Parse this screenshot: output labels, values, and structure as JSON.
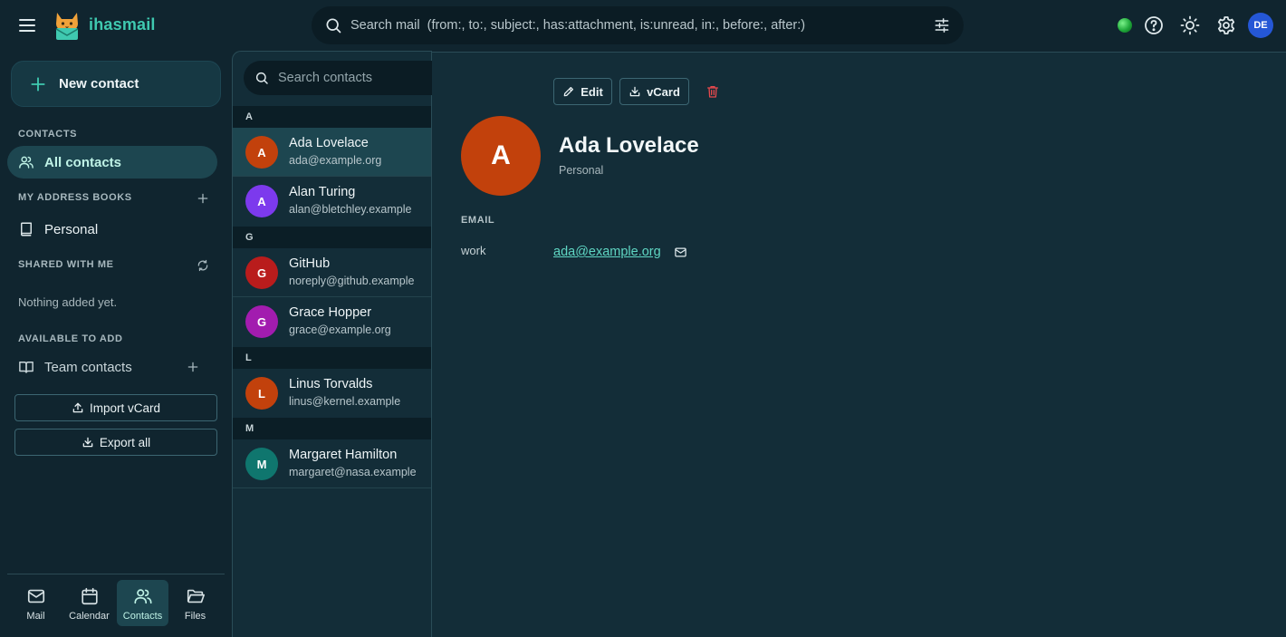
{
  "app": {
    "brand": "ihasmail",
    "search_placeholder": "Search mail  (from:, to:, subject:, has:attachment, is:unread, in:, before:, after:)",
    "user_initials": "DE",
    "colors": {
      "accent": "#3fc9b0",
      "background": "#10252f",
      "panel": "#132d38",
      "selected": "#1d4650"
    }
  },
  "sidebar": {
    "new_contact": "New contact",
    "contacts_label": "CONTACTS",
    "all_contacts": "All contacts",
    "my_address_books_label": "MY ADDRESS BOOKS",
    "personal": "Personal",
    "shared_label": "SHARED WITH ME",
    "shared_empty": "Nothing added yet.",
    "available_label": "AVAILABLE TO ADD",
    "team_contacts": "Team contacts",
    "import_vcard": "Import vCard",
    "export_all": "Export all"
  },
  "bottom_nav": {
    "mail": "Mail",
    "calendar": "Calendar",
    "contacts": "Contacts",
    "files": "Files"
  },
  "list": {
    "search_placeholder": "Search contacts",
    "groups": [
      "A",
      "G",
      "L",
      "M"
    ],
    "contacts": [
      {
        "initial": "A",
        "name": "Ada Lovelace",
        "email": "ada@example.org",
        "color": "#c2410c"
      },
      {
        "initial": "A",
        "name": "Alan Turing",
        "email": "alan@bletchley.example",
        "color": "#7c3aed"
      },
      {
        "initial": "G",
        "name": "GitHub",
        "email": "noreply@github.example",
        "color": "#b91c1c"
      },
      {
        "initial": "G",
        "name": "Grace Hopper",
        "email": "grace@example.org",
        "color": "#a21caf"
      },
      {
        "initial": "L",
        "name": "Linus Torvalds",
        "email": "linus@kernel.example",
        "color": "#c2410c"
      },
      {
        "initial": "M",
        "name": "Margaret Hamilton",
        "email": "margaret@nasa.example",
        "color": "#0f766e"
      }
    ]
  },
  "detail": {
    "edit": "Edit",
    "vcard": "vCard",
    "initial": "A",
    "name": "Ada Lovelace",
    "book": "Personal",
    "email_section": "EMAIL",
    "email_type": "work",
    "email": "ada@example.org"
  }
}
